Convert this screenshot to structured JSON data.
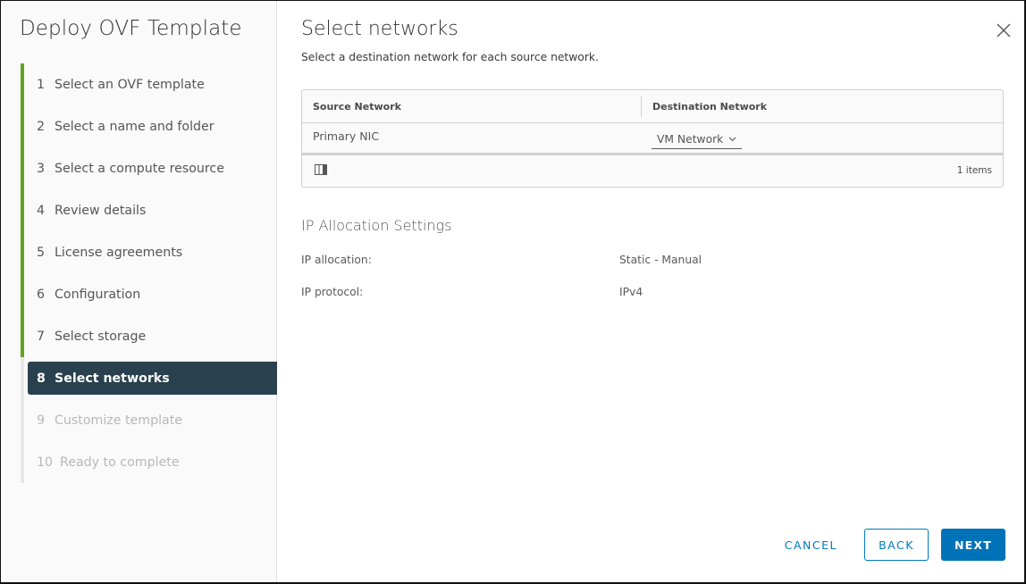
{
  "wizard": {
    "title": "Deploy OVF Template",
    "steps": [
      {
        "num": "1",
        "label": "Select an OVF template",
        "state": "done"
      },
      {
        "num": "2",
        "label": "Select a name and folder",
        "state": "done"
      },
      {
        "num": "3",
        "label": "Select a compute resource",
        "state": "done"
      },
      {
        "num": "4",
        "label": "Review details",
        "state": "done"
      },
      {
        "num": "5",
        "label": "License agreements",
        "state": "done"
      },
      {
        "num": "6",
        "label": "Configuration",
        "state": "done"
      },
      {
        "num": "7",
        "label": "Select storage",
        "state": "done"
      },
      {
        "num": "8",
        "label": "Select networks",
        "state": "active"
      },
      {
        "num": "9",
        "label": "Customize template",
        "state": "future"
      },
      {
        "num": "10",
        "label": "Ready to complete",
        "state": "future"
      }
    ]
  },
  "page": {
    "title": "Select networks",
    "subtitle": "Select a destination network for each source network.",
    "close_icon": "close-icon"
  },
  "grid": {
    "columns": [
      "Source Network",
      "Destination Network"
    ],
    "rows": [
      {
        "source": "Primary NIC",
        "destination": "VM Network"
      }
    ],
    "footer_count": "1 items",
    "column_toggle_icon": "column-toggle-icon"
  },
  "ip_settings": {
    "title": "IP Allocation Settings",
    "items": [
      {
        "label": "IP allocation:",
        "value": "Static - Manual"
      },
      {
        "label": "IP protocol:",
        "value": "IPv4"
      }
    ]
  },
  "footer": {
    "cancel": "CANCEL",
    "back": "BACK",
    "next": "NEXT"
  },
  "colors": {
    "accent": "#0072b8",
    "done_bar": "#62a420",
    "active_step_bg": "#29414e"
  }
}
